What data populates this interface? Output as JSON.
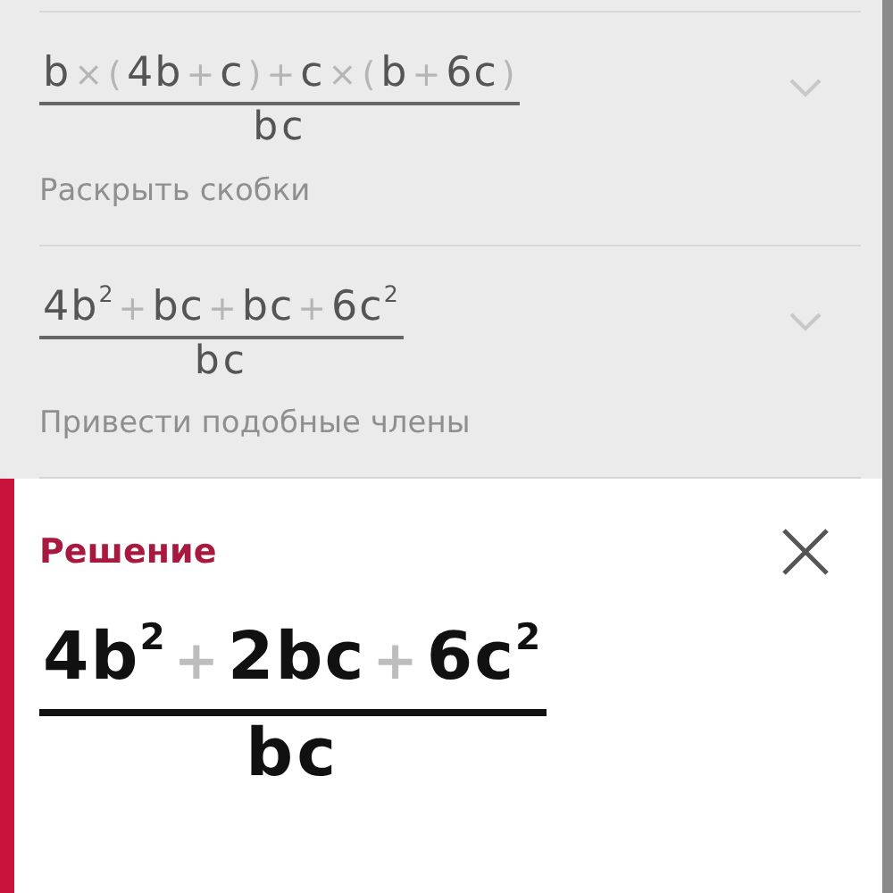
{
  "steps": [
    {
      "numerator": [
        {
          "kind": "term",
          "text": "b"
        },
        {
          "kind": "op",
          "text": "×"
        },
        {
          "kind": "op",
          "text": "("
        },
        {
          "kind": "term",
          "text": "4b"
        },
        {
          "kind": "op",
          "text": "+"
        },
        {
          "kind": "term",
          "text": "c"
        },
        {
          "kind": "op",
          "text": ")"
        },
        {
          "kind": "op",
          "text": "+"
        },
        {
          "kind": "term",
          "text": "c"
        },
        {
          "kind": "op",
          "text": "×"
        },
        {
          "kind": "op",
          "text": "("
        },
        {
          "kind": "term",
          "text": "b"
        },
        {
          "kind": "op",
          "text": "+"
        },
        {
          "kind": "term",
          "text": "6c"
        },
        {
          "kind": "op",
          "text": ")"
        }
      ],
      "denominator": "bc",
      "caption": "Раскрыть скобки"
    },
    {
      "numerator": [
        {
          "kind": "term",
          "text": "4b$^{2}$"
        },
        {
          "kind": "op",
          "text": "+"
        },
        {
          "kind": "term",
          "text": "bc"
        },
        {
          "kind": "op",
          "text": "+"
        },
        {
          "kind": "term",
          "text": "bc"
        },
        {
          "kind": "op",
          "text": "+"
        },
        {
          "kind": "term",
          "text": "6c$^{2}$"
        }
      ],
      "denominator": "bc",
      "caption": "Привести подобные члены"
    }
  ],
  "solution": {
    "title": "Решение",
    "numerator": [
      {
        "kind": "term",
        "text": "4b$^{2}$"
      },
      {
        "kind": "op",
        "text": "+"
      },
      {
        "kind": "term",
        "text": "2bc"
      },
      {
        "kind": "op",
        "text": "+"
      },
      {
        "kind": "term",
        "text": "6c$^{2}$"
      }
    ],
    "denominator": "bc"
  }
}
